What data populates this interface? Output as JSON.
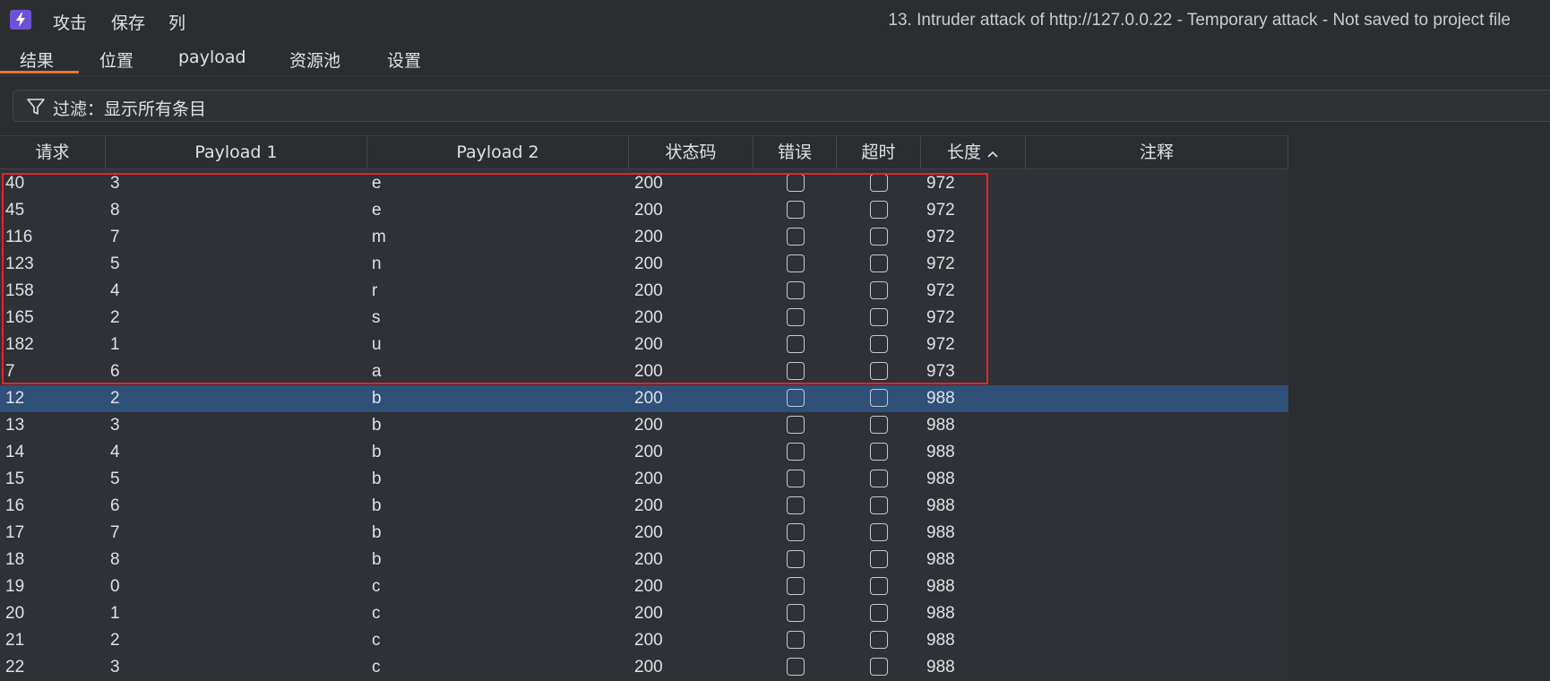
{
  "menu": {
    "attack": "攻击",
    "save": "保存",
    "columns": "列"
  },
  "window_title": "13. Intruder attack of http://127.0.0.22 - Temporary attack - Not saved to project file",
  "tabs": [
    {
      "label": "结果"
    },
    {
      "label": "位置"
    },
    {
      "label": "payload"
    },
    {
      "label": "资源池"
    },
    {
      "label": "设置"
    }
  ],
  "active_tab": "结果",
  "filter": {
    "text": "过滤：显示所有条目"
  },
  "columns": {
    "request": "请求",
    "payload1": "Payload 1",
    "payload2": "Payload 2",
    "status": "状态码",
    "error": "错误",
    "timeout": "超时",
    "length": "长度",
    "comment": "注释"
  },
  "sort": {
    "column": "length",
    "direction": "ascending"
  },
  "rows": [
    {
      "request": "40",
      "payload1": "3",
      "payload2": "e",
      "status": "200",
      "error": false,
      "timeout": false,
      "length": "972"
    },
    {
      "request": "45",
      "payload1": "8",
      "payload2": "e",
      "status": "200",
      "error": false,
      "timeout": false,
      "length": "972"
    },
    {
      "request": "116",
      "payload1": "7",
      "payload2": "m",
      "status": "200",
      "error": false,
      "timeout": false,
      "length": "972"
    },
    {
      "request": "123",
      "payload1": "5",
      "payload2": "n",
      "status": "200",
      "error": false,
      "timeout": false,
      "length": "972"
    },
    {
      "request": "158",
      "payload1": "4",
      "payload2": "r",
      "status": "200",
      "error": false,
      "timeout": false,
      "length": "972"
    },
    {
      "request": "165",
      "payload1": "2",
      "payload2": "s",
      "status": "200",
      "error": false,
      "timeout": false,
      "length": "972"
    },
    {
      "request": "182",
      "payload1": "1",
      "payload2": "u",
      "status": "200",
      "error": false,
      "timeout": false,
      "length": "972"
    },
    {
      "request": "7",
      "payload1": "6",
      "payload2": "a",
      "status": "200",
      "error": false,
      "timeout": false,
      "length": "973"
    },
    {
      "request": "12",
      "payload1": "2",
      "payload2": "b",
      "status": "200",
      "error": false,
      "timeout": false,
      "length": "988",
      "selected": true
    },
    {
      "request": "13",
      "payload1": "3",
      "payload2": "b",
      "status": "200",
      "error": false,
      "timeout": false,
      "length": "988"
    },
    {
      "request": "14",
      "payload1": "4",
      "payload2": "b",
      "status": "200",
      "error": false,
      "timeout": false,
      "length": "988"
    },
    {
      "request": "15",
      "payload1": "5",
      "payload2": "b",
      "status": "200",
      "error": false,
      "timeout": false,
      "length": "988"
    },
    {
      "request": "16",
      "payload1": "6",
      "payload2": "b",
      "status": "200",
      "error": false,
      "timeout": false,
      "length": "988"
    },
    {
      "request": "17",
      "payload1": "7",
      "payload2": "b",
      "status": "200",
      "error": false,
      "timeout": false,
      "length": "988"
    },
    {
      "request": "18",
      "payload1": "8",
      "payload2": "b",
      "status": "200",
      "error": false,
      "timeout": false,
      "length": "988"
    },
    {
      "request": "19",
      "payload1": "0",
      "payload2": "c",
      "status": "200",
      "error": false,
      "timeout": false,
      "length": "988"
    },
    {
      "request": "20",
      "payload1": "1",
      "payload2": "c",
      "status": "200",
      "error": false,
      "timeout": false,
      "length": "988"
    },
    {
      "request": "21",
      "payload1": "2",
      "payload2": "c",
      "status": "200",
      "error": false,
      "timeout": false,
      "length": "988"
    },
    {
      "request": "22",
      "payload1": "3",
      "payload2": "c",
      "status": "200",
      "error": false,
      "timeout": false,
      "length": "988"
    }
  ],
  "colors": {
    "accent": "#e8743b",
    "selection": "#2e5079",
    "highlight_box": "#e8222b",
    "app_icon": "#6c52d6"
  },
  "icons": {
    "app": "lightning-bolt-icon",
    "filter": "funnel-icon",
    "sort": "chevron-up-icon"
  }
}
